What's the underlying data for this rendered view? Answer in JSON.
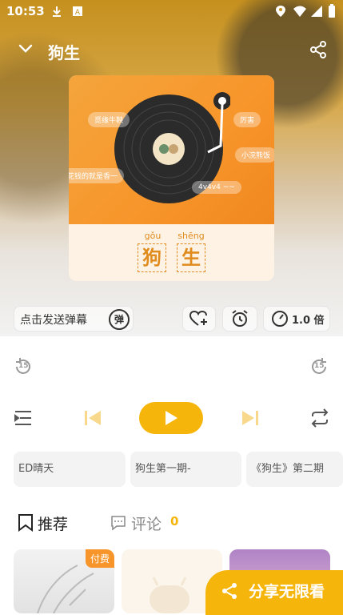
{
  "status_bar": {
    "time": "10:53"
  },
  "header": {
    "title": "狗生"
  },
  "cover": {
    "bubbles": [
      "觅缘牛鞅",
      "厉害",
      "小浣熊饭",
      "花钱的就是香一",
      "4v4v4 ~~"
    ],
    "chars": [
      {
        "pinyin": "gǒu",
        "hanzi": "狗"
      },
      {
        "pinyin": "shēng",
        "hanzi": "生"
      }
    ]
  },
  "controls": {
    "danmaku_placeholder": "点击发送弹幕",
    "danmaku_badge": "弹",
    "speed_label": "1.0 倍",
    "skip_seconds": "15"
  },
  "playlist": [
    "ED晴天",
    "狗生第一期-",
    "《狗生》第二期"
  ],
  "tabs": {
    "recommend": "推荐",
    "comments": "评论",
    "comment_count": "0"
  },
  "cards": {
    "paid_badge": "付费"
  },
  "share": {
    "label": "分享无限看"
  },
  "colors": {
    "accent": "#f5b50b",
    "orange": "#f7952a"
  }
}
